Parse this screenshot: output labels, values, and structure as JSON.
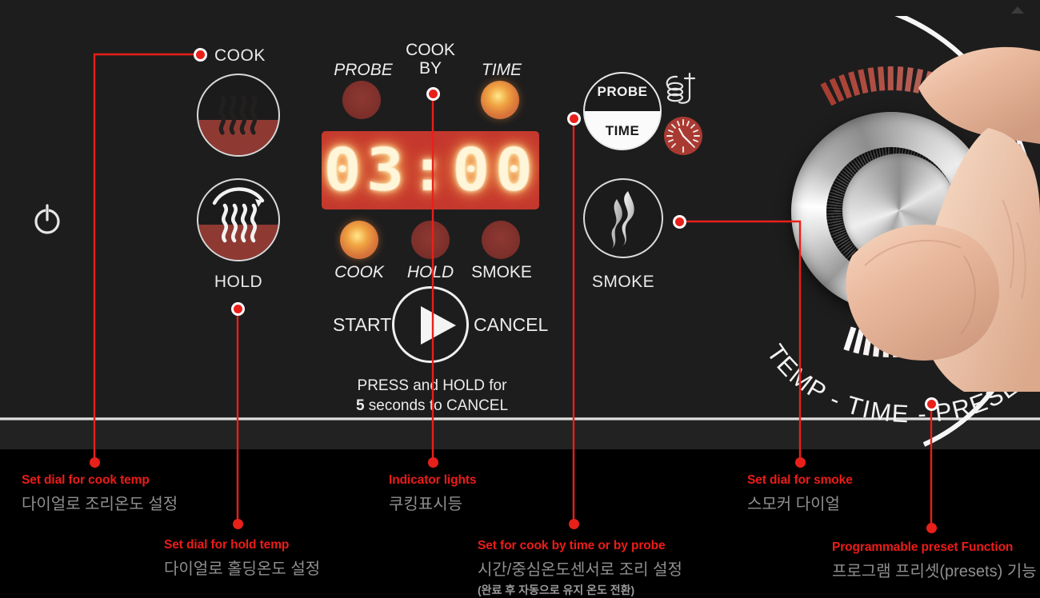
{
  "device": {
    "panel_label": "smoker-oven-control-panel",
    "display_value": "03:00",
    "colors": {
      "panel_bg": "#1e1d1d",
      "accent_red": "#ec1c18",
      "display_bg": "#c4372e",
      "led_on": "#f0a341",
      "led_off": "#7e302b",
      "caption_kr": "#8f8f8f"
    }
  },
  "controls": {
    "power_icon": "power-icon",
    "cook_button_label": "COOK",
    "hold_button_label": "HOLD",
    "probe_half_label": "PROBE",
    "time_half_label": "TIME",
    "smoke_button_label": "SMOKE",
    "start_label": "START",
    "cancel_label": "CANCEL",
    "press_hold_line1": "PRESS and HOLD for",
    "press_hold_line2_bold": "5",
    "press_hold_line2_rest": " seconds to CANCEL",
    "probe_icon": "probe-needle-icon",
    "clock_icon": "clock-icon",
    "play_icon": "play-triangle-icon"
  },
  "indicators": {
    "cook_by_label_line1": "COOK",
    "cook_by_label_line2": "BY",
    "top_row": [
      {
        "label": "PROBE",
        "state": "off",
        "italic": true
      },
      {
        "label": "TIME",
        "state": "on",
        "italic": true
      }
    ],
    "bottom_row": [
      {
        "label": "COOK",
        "state": "on",
        "italic": true
      },
      {
        "label": "HOLD",
        "state": "off",
        "italic": true
      },
      {
        "label": "SMOKE",
        "state": "off",
        "italic": false
      }
    ]
  },
  "dial": {
    "legend": "TEMP - TIME - PRESET",
    "legend_visible": "TEMP - TIME - PRESE",
    "tick_count": 58
  },
  "callouts": [
    {
      "id": "cook-temp",
      "en": "Set dial for cook temp",
      "kr": "다이얼로 조리온도 설정"
    },
    {
      "id": "hold-temp",
      "en": "Set dial for hold temp",
      "kr": "다이얼로 홀딩온도 설정"
    },
    {
      "id": "indicator-lights",
      "en": "Indicator lights",
      "kr": "쿠킹표시등"
    },
    {
      "id": "cook-by-time-probe",
      "en": "Set for cook by time or by probe",
      "kr": "시간/중심온도센서로 조리 설정",
      "kr2": "(완료 후 자동으로 유지 온도 전환)"
    },
    {
      "id": "smoke-dial",
      "en": "Set dial for smoke",
      "kr": "스모커 다이얼"
    },
    {
      "id": "preset-function",
      "en": "Programmable preset Function",
      "kr": "프로그램 프리셋(presets) 기능"
    }
  ]
}
